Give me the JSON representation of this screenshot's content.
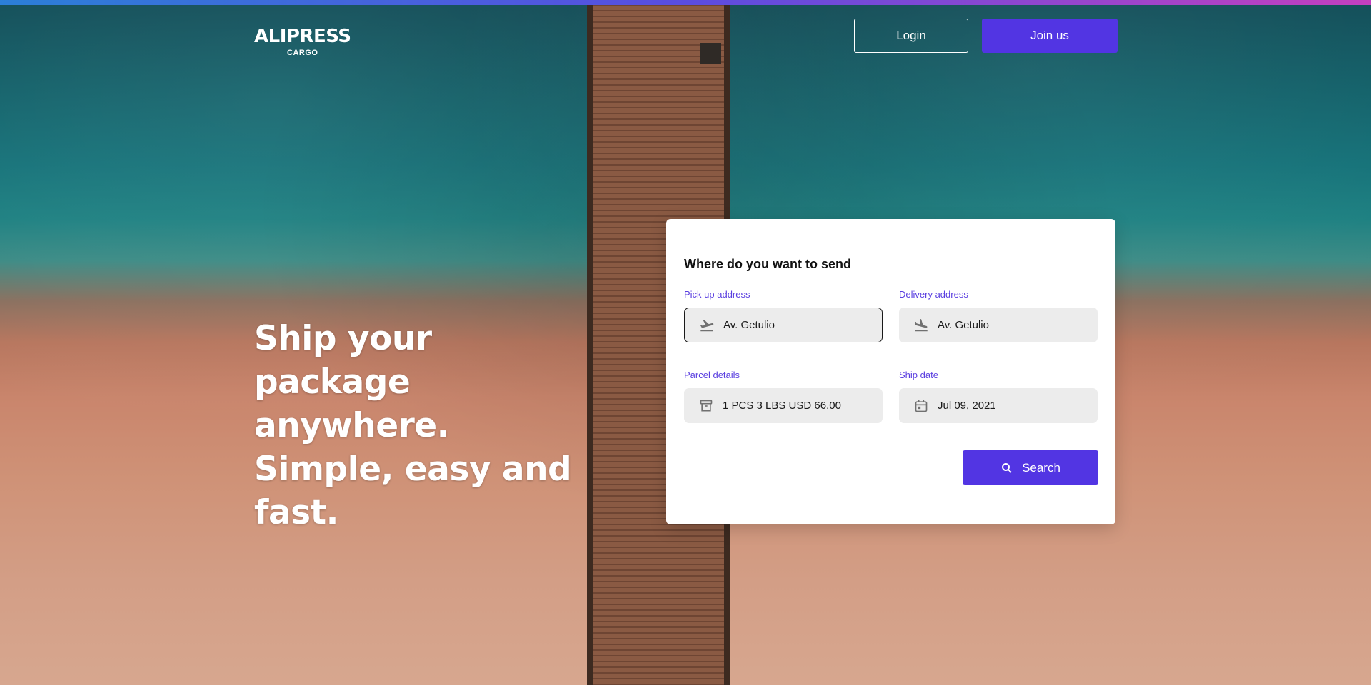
{
  "header": {
    "logo_main": "ALIPRESS",
    "logo_sub": "CARGO",
    "login_label": "Login",
    "join_label": "Join us"
  },
  "hero": {
    "headline": "Ship your package anywhere. Simple, easy and fast."
  },
  "search_card": {
    "title": "Where do you want to send",
    "pickup": {
      "label": "Pick up address",
      "value": "Av. Getulio",
      "icon": "plane-takeoff-icon"
    },
    "delivery": {
      "label": "Delivery address",
      "value": "Av. Getulio",
      "icon": "plane-landing-icon"
    },
    "parcel": {
      "label": "Parcel details",
      "value": "1 PCS 3 LBS USD 66.00",
      "icon": "archive-box-icon"
    },
    "ship_date": {
      "label": "Ship date",
      "value": "Jul 09, 2021",
      "icon": "calendar-icon"
    },
    "search_label": "Search"
  },
  "colors": {
    "accent": "#5235e3",
    "label": "#5a3fe0",
    "field_bg": "#ececec"
  }
}
